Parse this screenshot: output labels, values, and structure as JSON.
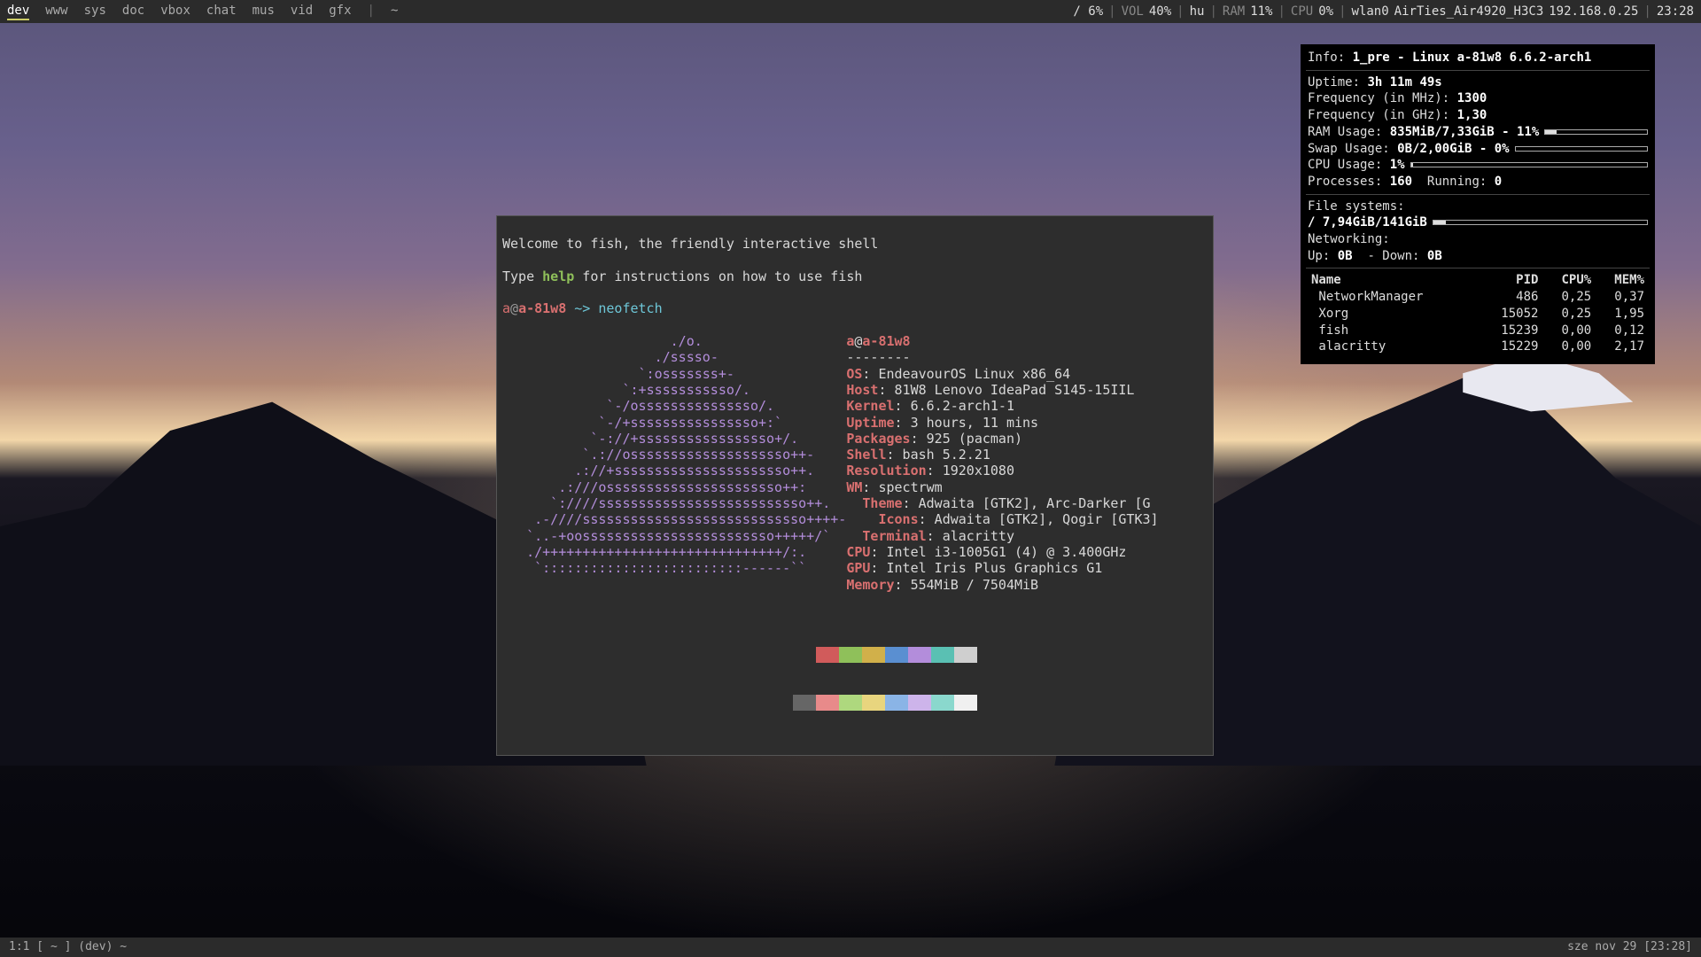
{
  "topbar": {
    "workspaces": [
      "dev",
      "www",
      "sys",
      "doc",
      "vbox",
      "chat",
      "mus",
      "vid",
      "gfx"
    ],
    "active_ws": "dev",
    "title_sep": "|",
    "title": "~",
    "disk": "/ 6%",
    "vol_label": "VOL",
    "vol_value": "40%",
    "kbd": "hu",
    "ram_label": "RAM",
    "ram_value": "11%",
    "cpu_label": "CPU",
    "cpu_value": "0%",
    "net_iface": "wlan0",
    "net_ssid": "AirTies_Air4920_H3C3",
    "net_ip": "192.168.0.25",
    "clock": "23:28"
  },
  "term": {
    "welcome1": "Welcome to fish, the friendly interactive shell",
    "welcome2a": "Type ",
    "welcome2_help": "help",
    "welcome2b": " for instructions on how to use fish",
    "prompt_user": "a",
    "prompt_at": "@",
    "prompt_host": "a-81w8",
    "prompt_dir": " ~> ",
    "cmd": "neofetch",
    "logo": [
      "                     ./",
      "                   ./",
      "                 `:",
      "               `:+",
      "             `-/",
      "            `-/+",
      "           `-://+",
      "          `.://",
      "         .://+",
      "       .:///",
      "      `:////",
      "    .-////",
      "   `..-+",
      "   ./",
      "    `:::::::::::::::::::::::::------``"
    ],
    "logo_ss": [
      "o",
      "sssso",
      "osssssss",
      "sssssssssso",
      "osssssssssssssso",
      "ssssssssssssssso",
      "sssssssssssssssso",
      "ossssssssssssssssssso",
      "ssssssssssssssssssssso",
      "ossssssssssssssssssssso",
      "ssssssssssssssssssssssssso",
      "ssssssssssssssssssssssssssso",
      "oossssssssssssssssssssssso",
      "++++++++++++++++++++++++++++++",
      ""
    ],
    "logo_tail": [
      ".",
      "-",
      "+-",
      "/.",
      "/.",
      "+:`",
      "+/.",
      "++-",
      "++.",
      "++:",
      "++.",
      "++++-",
      "+++++/`",
      "/:.",
      ""
    ],
    "info_header_user": "a",
    "info_header_at": "@",
    "info_header_host": "a-81w8",
    "info_sep": "--------",
    "info": [
      [
        "OS",
        ": EndeavourOS Linux x86_64"
      ],
      [
        "Host",
        ": 81W8 Lenovo IdeaPad S145-15IIL"
      ],
      [
        "Kernel",
        ": 6.6.2-arch1-1"
      ],
      [
        "Uptime",
        ": 3 hours, 11 mins"
      ],
      [
        "Packages",
        ": 925 (pacman)"
      ],
      [
        "Shell",
        ": bash 5.2.21"
      ],
      [
        "Resolution",
        ": 1920x1080"
      ],
      [
        "WM",
        ": spectrwm"
      ],
      [
        "Theme",
        ": Adwaita [GTK2], Arc-Darker [G"
      ],
      [
        "Icons",
        ": Adwaita [GTK2], Qogir [GTK3]"
      ],
      [
        "Terminal",
        ": alacritty"
      ],
      [
        "CPU",
        ": Intel i3-1005G1 (4) @ 3.400GHz"
      ],
      [
        "GPU",
        ": Intel Iris Plus Graphics G1"
      ],
      [
        "Memory",
        ": 554MiB / 7504MiB"
      ]
    ],
    "palette_dark": [
      "#2d2d2d",
      "#d15b5b",
      "#8fc05a",
      "#d1b04a",
      "#5a8fd1",
      "#b38ddb",
      "#5ac0b3",
      "#cfcfcf"
    ],
    "palette_light": [
      "#666666",
      "#e88a8a",
      "#aed87e",
      "#e8d57e",
      "#8ab4e6",
      "#cdb4ea",
      "#8ad8cd",
      "#f0f0f0"
    ]
  },
  "conky": {
    "info_label": "Info:",
    "info_value": "1_pre - Linux a-81w8 6.6.2-arch1",
    "uptime_label": "Uptime:",
    "uptime_value": "3h 11m 49s",
    "freq_mhz_label": "Frequency (in MHz):",
    "freq_mhz_value": "1300",
    "freq_ghz_label": "Frequency (in GHz):",
    "freq_ghz_value": "1,30",
    "ram_label": "RAM Usage:",
    "ram_value": "835MiB/7,33GiB - 11%",
    "ram_pct": 11,
    "swap_label": "Swap Usage:",
    "swap_value": "0B/2,00GiB - 0%",
    "swap_pct": 0,
    "cpu_label": "CPU Usage:",
    "cpu_value": "1%",
    "cpu_pct": 1,
    "proc_label": "Processes:",
    "proc_value": "160",
    "run_label": "Running:",
    "run_value": "0",
    "fs_header": "File systems:",
    "fs_line": " / 7,94GiB/141GiB",
    "fs_pct": 6,
    "net_header": "Networking:",
    "net_up_label": "Up:",
    "net_up_value": "0B",
    "net_down_label": "- Down:",
    "net_down_value": "0B",
    "proc_table": {
      "headers": [
        "Name",
        "PID",
        "CPU%",
        "MEM%"
      ],
      "rows": [
        [
          "NetworkManager",
          "486",
          "0,25",
          "0,37"
        ],
        [
          "Xorg",
          "15052",
          "0,25",
          "1,95"
        ],
        [
          "fish",
          "15239",
          "0,00",
          "0,12"
        ],
        [
          "alacritty",
          "15229",
          "0,00",
          "2,17"
        ]
      ]
    }
  },
  "botbar": {
    "left": "1:1 [ ~ ] (dev) ~",
    "right": "sze nov 29 [23:28]"
  }
}
